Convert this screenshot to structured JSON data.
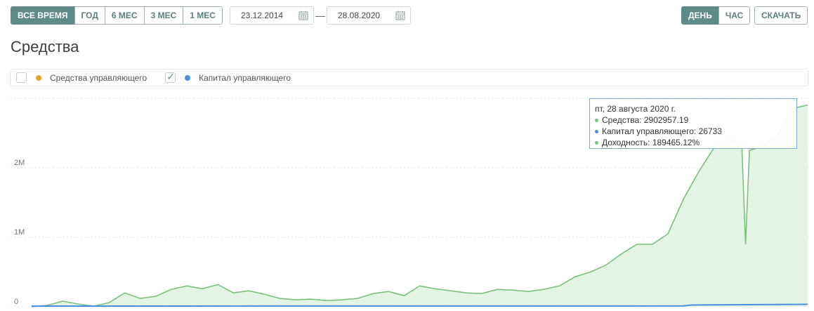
{
  "toolbar": {
    "periods": [
      {
        "label": "ВСЕ ВРЕМЯ",
        "active": true
      },
      {
        "label": "ГОД",
        "active": false
      },
      {
        "label": "6 МЕС",
        "active": false
      },
      {
        "label": "3 МЕС",
        "active": false
      },
      {
        "label": "1 МЕС",
        "active": false
      }
    ],
    "date_from": "23.12.2014",
    "date_to": "28.08.2020",
    "date_separator": "—",
    "scale": [
      {
        "label": "ДЕНЬ",
        "active": true
      },
      {
        "label": "ЧАС",
        "active": false
      }
    ],
    "download_label": "СКАЧАТЬ"
  },
  "title": "Средства",
  "legend": [
    {
      "label": "Средства управляющего",
      "checked": false,
      "color": "#f0a030"
    },
    {
      "label": "Капитал управляющего",
      "checked": true,
      "color": "#4a90e2"
    }
  ],
  "tooltip": {
    "header": "пт, 28 августа 2020 г.",
    "rows": [
      {
        "label": "Средства",
        "value": "2902957.19",
        "color": "#7cc07c"
      },
      {
        "label": "Капитал управляющего",
        "value": "26733",
        "color": "#4a90e2"
      },
      {
        "label": "Доходность",
        "value": "189465.12%",
        "color": "#7cc07c"
      }
    ]
  },
  "chart_data": {
    "type": "area",
    "x_range": [
      "23.12.2014",
      "28.08.2020"
    ],
    "y_ticks": [
      "0",
      "1M",
      "2M"
    ],
    "ylim": [
      0,
      3100000
    ],
    "grid": true,
    "series": [
      {
        "name": "Средства",
        "color": "#7cc07c",
        "fill": "#e4f4e4",
        "points": [
          [
            0,
            0
          ],
          [
            0.02,
            20000
          ],
          [
            0.04,
            80000
          ],
          [
            0.06,
            40000
          ],
          [
            0.08,
            10000
          ],
          [
            0.1,
            60000
          ],
          [
            0.12,
            200000
          ],
          [
            0.14,
            120000
          ],
          [
            0.16,
            150000
          ],
          [
            0.18,
            250000
          ],
          [
            0.2,
            300000
          ],
          [
            0.22,
            260000
          ],
          [
            0.24,
            320000
          ],
          [
            0.26,
            200000
          ],
          [
            0.28,
            230000
          ],
          [
            0.3,
            180000
          ],
          [
            0.32,
            120000
          ],
          [
            0.34,
            100000
          ],
          [
            0.36,
            110000
          ],
          [
            0.38,
            90000
          ],
          [
            0.4,
            100000
          ],
          [
            0.42,
            120000
          ],
          [
            0.44,
            190000
          ],
          [
            0.46,
            220000
          ],
          [
            0.48,
            160000
          ],
          [
            0.5,
            300000
          ],
          [
            0.52,
            260000
          ],
          [
            0.54,
            230000
          ],
          [
            0.56,
            200000
          ],
          [
            0.58,
            190000
          ],
          [
            0.6,
            250000
          ],
          [
            0.62,
            240000
          ],
          [
            0.64,
            220000
          ],
          [
            0.66,
            250000
          ],
          [
            0.68,
            300000
          ],
          [
            0.7,
            430000
          ],
          [
            0.72,
            500000
          ],
          [
            0.74,
            600000
          ],
          [
            0.76,
            760000
          ],
          [
            0.78,
            900000
          ],
          [
            0.8,
            900000
          ],
          [
            0.82,
            1050000
          ],
          [
            0.84,
            1550000
          ],
          [
            0.86,
            1950000
          ],
          [
            0.88,
            2300000
          ],
          [
            0.9,
            2400000
          ],
          [
            0.915,
            2350000
          ],
          [
            0.92,
            900000
          ],
          [
            0.925,
            2250000
          ],
          [
            0.94,
            2300000
          ],
          [
            0.96,
            2450000
          ],
          [
            0.98,
            2850000
          ],
          [
            1.0,
            2902957
          ]
        ]
      },
      {
        "name": "Капитал управляющего",
        "color": "#4a90e2",
        "points": [
          [
            0,
            0
          ],
          [
            0.84,
            2000
          ],
          [
            0.85,
            15000
          ],
          [
            1.0,
            26733
          ]
        ]
      }
    ]
  }
}
